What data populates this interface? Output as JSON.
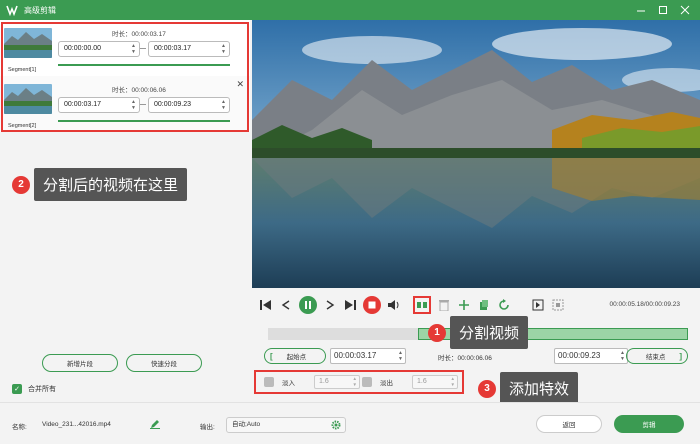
{
  "window": {
    "title": "高级剪辑"
  },
  "segments": [
    {
      "label": "Segment[1]",
      "duration": "时长：00:00:03.17",
      "start": "00:00:00.00",
      "end": "00:00:03.17"
    },
    {
      "label": "Segment[2]",
      "duration": "时长：00:00:06.06",
      "start": "00:00:03.17",
      "end": "00:00:09.23"
    }
  ],
  "annotations": [
    {
      "number": "2",
      "text": "分割后的视频在这里"
    },
    {
      "number": "1",
      "text": "分割视频"
    },
    {
      "number": "3",
      "text": "添加特效"
    }
  ],
  "left_actions": {
    "new_segment": "新增片段",
    "quick_split": "快速分段",
    "merge_all": "合并所有"
  },
  "player": {
    "time": "00:00:05.18/00:00:09.23"
  },
  "trim": {
    "start_button": "起始点",
    "start_time": "00:00:03.17",
    "duration": "时长：00:00:06.06",
    "end_time": "00:00:09.23",
    "end_button": "结束点"
  },
  "effects": {
    "fade_in_label": "淡入",
    "fade_in_value": "1.6",
    "fade_out_label": "淡出",
    "fade_out_value": "1.6"
  },
  "bottom": {
    "name_label": "名称:",
    "file_name": "Video_231...42016.mp4",
    "output_label": "输出:",
    "output_value": "自动;Auto",
    "back_button": "返回",
    "cut_button": "剪辑"
  },
  "colors": {
    "accent": "#3b9b52",
    "highlight": "#e53935",
    "callout_bg": "#555555"
  }
}
